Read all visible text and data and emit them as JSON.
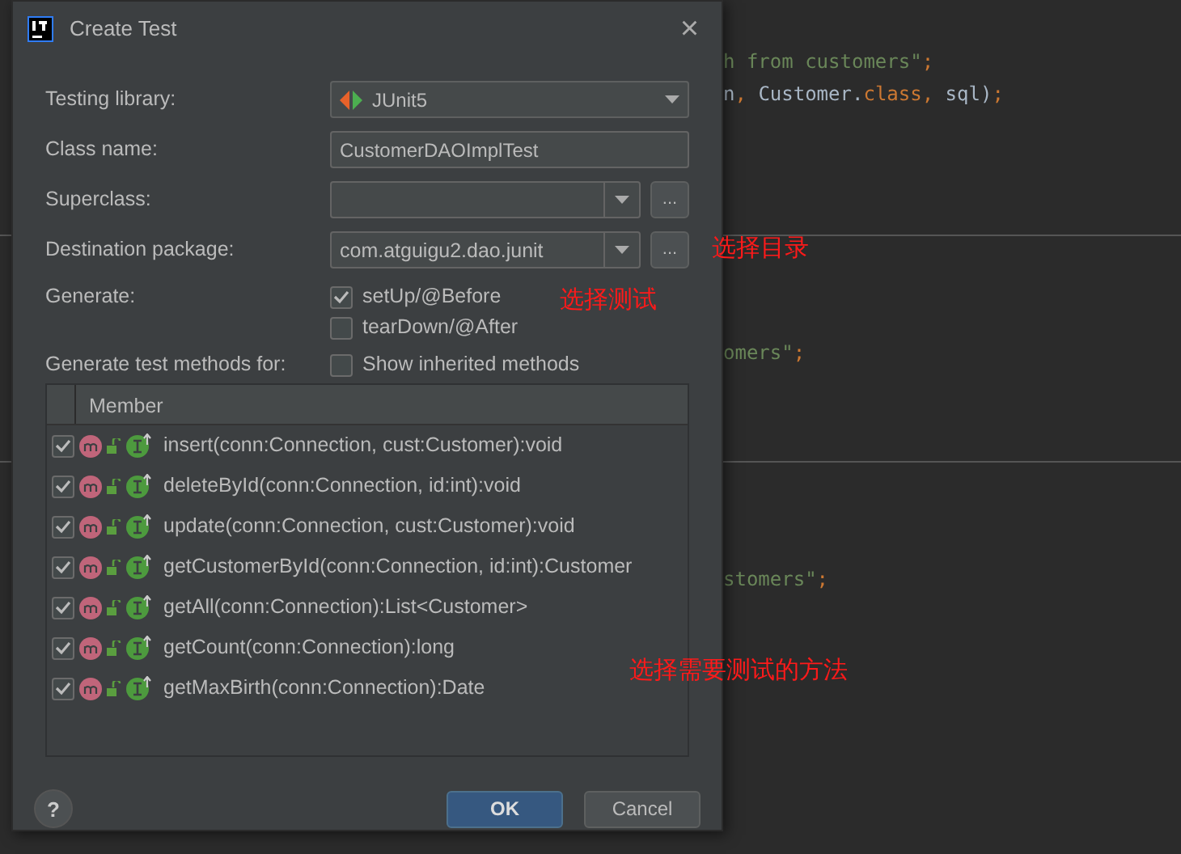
{
  "editor": {
    "blocks": [
      {
        "lines": [
          [
            {
              "kind": "string",
              "text": "h from customers\""
            },
            {
              "kind": "keyword",
              "text": ";"
            }
          ],
          [
            {
              "kind": "plain",
              "text": "n"
            },
            {
              "kind": "keyword",
              "text": ", "
            },
            {
              "kind": "plain",
              "text": "Customer."
            },
            {
              "kind": "keyword",
              "text": "class, "
            },
            {
              "kind": "plain",
              "text": "sql)"
            },
            {
              "kind": "keyword",
              "text": ";"
            }
          ]
        ]
      },
      {
        "lines": [
          [
            {
              "kind": "string",
              "text": "omers\""
            },
            {
              "kind": "keyword",
              "text": ";"
            }
          ]
        ]
      },
      {
        "lines": [
          [
            {
              "kind": "string",
              "text": "stomers\""
            },
            {
              "kind": "keyword",
              "text": ";"
            }
          ]
        ]
      }
    ]
  },
  "dialog": {
    "title": "Create Test",
    "close": "×",
    "fields": [
      {
        "kind": "dropdown",
        "label": "Testing library:",
        "value": "JUnit5"
      },
      {
        "kind": "text",
        "label": "Class name:",
        "value": "CustomerDAOImplTest"
      },
      {
        "kind": "combo",
        "label": "Superclass:",
        "browse": "..."
      },
      {
        "kind": "combo",
        "label": "Destination package:",
        "value": "com.atguigu2.dao.junit",
        "browse": "..."
      }
    ],
    "generate": {
      "label": "Generate:",
      "options": [
        {
          "label": "setUp/@Before",
          "checked": true
        },
        {
          "label": "tearDown/@After",
          "checked": false
        }
      ]
    },
    "methods_for": {
      "label": "Generate test methods for:",
      "option": {
        "label": "Show inherited methods",
        "checked": false
      }
    },
    "table": {
      "columns": [
        "Member"
      ],
      "rows": [
        {
          "checked": true,
          "signature": "insert(conn:Connection, cust:Customer):void"
        },
        {
          "checked": true,
          "signature": "deleteById(conn:Connection, id:int):void"
        },
        {
          "checked": true,
          "signature": "update(conn:Connection, cust:Customer):void"
        },
        {
          "checked": true,
          "signature": "getCustomerById(conn:Connection, id:int):Customer"
        },
        {
          "checked": true,
          "signature": "getAll(conn:Connection):List<Customer>"
        },
        {
          "checked": true,
          "signature": "getCount(conn:Connection):long"
        },
        {
          "checked": true,
          "signature": "getMaxBirth(conn:Connection):Date"
        }
      ]
    },
    "help": "?",
    "buttons": [
      {
        "kind": "primary",
        "label": "OK"
      },
      {
        "kind": "secondary",
        "label": "Cancel"
      }
    ]
  },
  "annotations": [
    {
      "text": "选择目录"
    },
    {
      "text": "选择测试"
    },
    {
      "text": "选择需要测试的方法"
    }
  ]
}
